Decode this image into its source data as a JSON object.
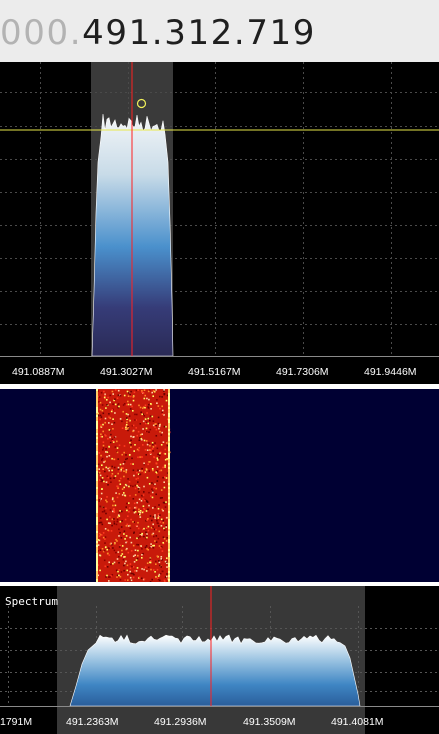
{
  "frequency": {
    "prefix": "000.",
    "value": "491.312.719"
  },
  "spectrum": {
    "axis_labels": [
      "491.0887M",
      "491.3027M",
      "491.5167M",
      "491.7306M",
      "491.9446M"
    ],
    "colors": {
      "background": "#000000",
      "grid": "#4a4a4a",
      "selection_band": "#3a3a3a",
      "center_line": "#ff2020",
      "marker": "#e8e84a",
      "trace_top": "#f4f6f8",
      "trace_mid": "#4a90cc",
      "trace_bottom": "#2a2a55"
    },
    "peak_marker_icon": "circle-marker-icon"
  },
  "waterfall": {
    "colors": {
      "background": "#000033",
      "signal_hot": "#ffff66",
      "signal_core": "#e02010",
      "signal_dark": "#a00000"
    }
  },
  "mini_spectrum": {
    "title": "Spectrum",
    "axis_labels": [
      "1791M",
      "491.2363M",
      "491.2936M",
      "491.3509M",
      "491.4081M"
    ],
    "colors": {
      "background": "#000000",
      "grid": "#555555",
      "selection_band": "#383838",
      "center_line": "#ff2020"
    }
  }
}
